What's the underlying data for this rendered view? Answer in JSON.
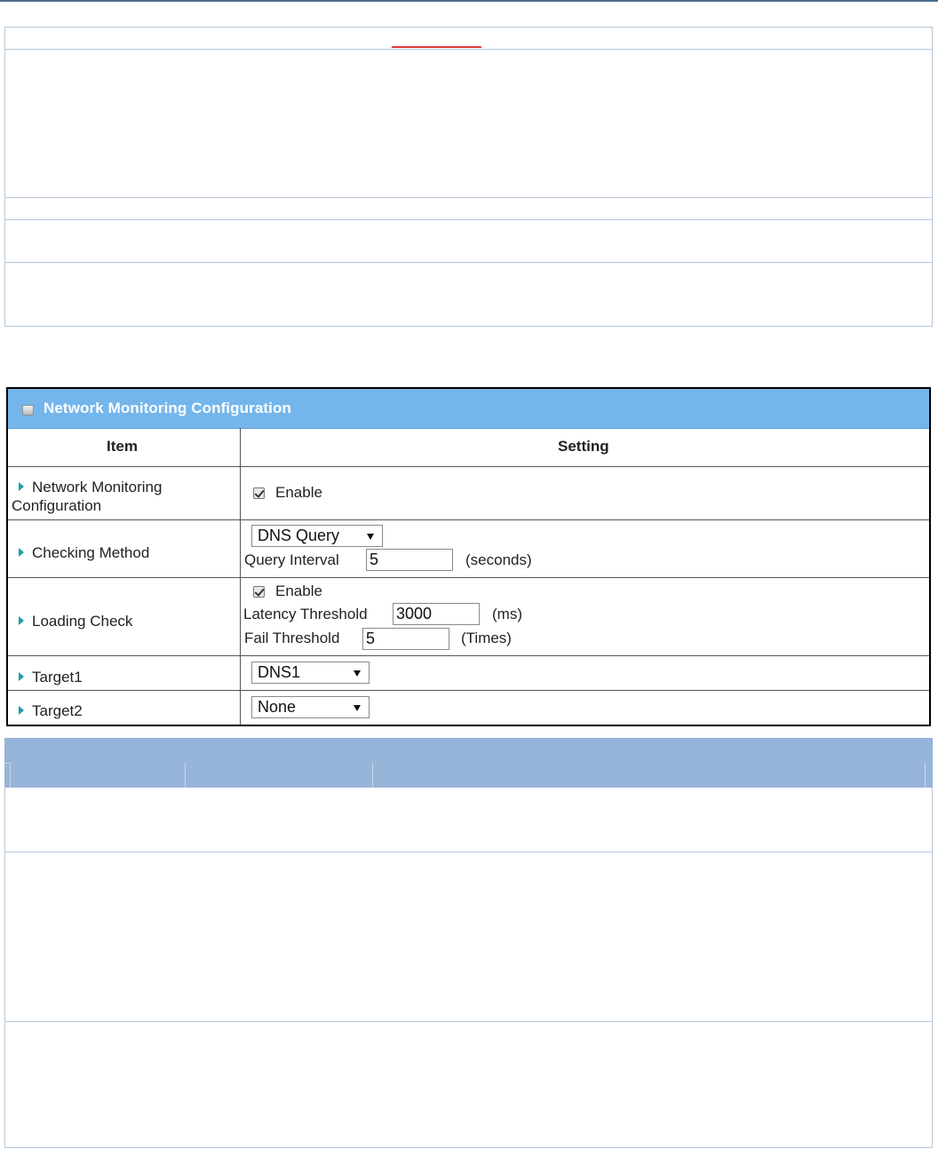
{
  "panel": {
    "title": "Network Monitoring Configuration",
    "columns": {
      "item": "Item",
      "setting": "Setting"
    }
  },
  "rows": {
    "network_monitoring": {
      "label_line1": "Network Monitoring",
      "label_line2": "Configuration",
      "enable_label": "Enable",
      "enabled": true
    },
    "checking_method": {
      "label": "Checking Method",
      "method_value": "DNS Query",
      "interval_label": "Query Interval",
      "interval_value": "5",
      "interval_unit": "(seconds)"
    },
    "loading_check": {
      "label": "Loading Check",
      "enable_label": "Enable",
      "enabled": true,
      "latency_label": "Latency Threshold",
      "latency_value": "3000",
      "latency_unit": "(ms)",
      "fail_label": "Fail Threshold",
      "fail_value": "5",
      "fail_unit": "(Times)"
    },
    "target1": {
      "label": "Target1",
      "value": "DNS1"
    },
    "target2": {
      "label": "Target2",
      "value": "None"
    }
  },
  "colors": {
    "header_blue": "#74b6ec",
    "lower_header_blue": "#97b4d9",
    "arrow_teal": "#1f9ea8",
    "border_blue": "#b7c7d9"
  }
}
